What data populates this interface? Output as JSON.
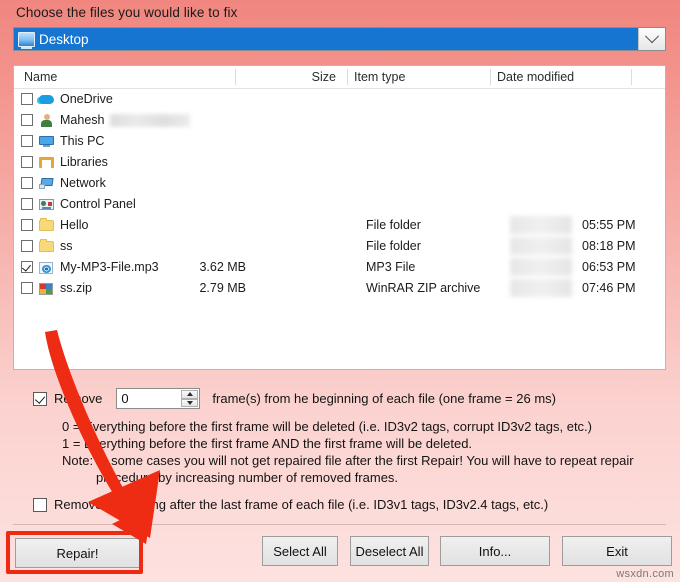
{
  "window": {
    "prompt": "Choose the files you would like to fix",
    "watermark": "wsxdn.com"
  },
  "location_combo": {
    "icon": "desktop-icon",
    "value": "Desktop",
    "arrow_icon": "chevron-down-icon"
  },
  "file_list": {
    "columns": [
      "Name",
      "Size",
      "Item type",
      "Date modified"
    ],
    "rows": [
      {
        "checked": false,
        "icon": "onedrive-icon",
        "name": "OneDrive",
        "size": "",
        "type": "",
        "date": "",
        "time": "",
        "redacted_name": false,
        "redacted_date": false
      },
      {
        "checked": false,
        "icon": "user-icon",
        "name": "Mahesh",
        "size": "",
        "type": "",
        "date": "",
        "time": "",
        "redacted_name": true,
        "redacted_date": false
      },
      {
        "checked": false,
        "icon": "this-pc-icon",
        "name": "This PC",
        "size": "",
        "type": "",
        "date": "",
        "time": "",
        "redacted_name": false,
        "redacted_date": false
      },
      {
        "checked": false,
        "icon": "libraries-icon",
        "name": "Libraries",
        "size": "",
        "type": "",
        "date": "",
        "time": "",
        "redacted_name": false,
        "redacted_date": false
      },
      {
        "checked": false,
        "icon": "network-icon",
        "name": "Network",
        "size": "",
        "type": "",
        "date": "",
        "time": "",
        "redacted_name": false,
        "redacted_date": false
      },
      {
        "checked": false,
        "icon": "control-panel-icon",
        "name": "Control Panel",
        "size": "",
        "type": "",
        "date": "",
        "time": "",
        "redacted_name": false,
        "redacted_date": false
      },
      {
        "checked": false,
        "icon": "folder-icon",
        "name": "Hello",
        "size": "",
        "type": "File folder",
        "date": "",
        "time": "05:55 PM",
        "redacted_name": false,
        "redacted_date": true
      },
      {
        "checked": false,
        "icon": "folder-icon",
        "name": "ss",
        "size": "",
        "type": "File folder",
        "date": "",
        "time": "08:18 PM",
        "redacted_name": false,
        "redacted_date": true
      },
      {
        "checked": true,
        "icon": "mp3-file-icon",
        "name": "My-MP3-File.mp3",
        "size": "3.62 MB",
        "type": "MP3 File",
        "date": "",
        "time": "06:53 PM",
        "redacted_name": false,
        "redacted_date": true
      },
      {
        "checked": false,
        "icon": "winrar-zip-icon",
        "name": "ss.zip",
        "size": "2.79 MB",
        "type": "WinRAR ZIP archive",
        "date": "",
        "time": "07:46 PM",
        "redacted_name": false,
        "redacted_date": true
      }
    ]
  },
  "options": {
    "remove_frames": {
      "checked": true,
      "label": "Remove",
      "value": "0",
      "placeholder": "0",
      "suffix": "frame(s) from he beginning of each file (one frame = 26 ms)"
    },
    "help_lines": [
      "0 = Everything before the first frame will be deleted (i.e. ID3v2 tags, corrupt ID3v2 tags, etc.)",
      "1 = Everything before the first frame AND the first frame will be deleted.",
      "Note: In some cases you will not get repaired file after the first Repair! You will have to repeat repair",
      "procedure by increasing number of removed frames."
    ],
    "remove_after_last": {
      "checked": false,
      "label": "Remove everything after the last frame of each file (i.e. ID3v1 tags, ID3v2.4 tags, etc.)"
    }
  },
  "buttons": {
    "repair": "Repair!",
    "select_all": "Select All",
    "deselect_all": "Deselect All",
    "info": "Info...",
    "exit": "Exit"
  },
  "annotations": {
    "arrow_color": "#ee2b13",
    "highlight_color": "#ef2a13",
    "highlight_target": "Repair!"
  }
}
